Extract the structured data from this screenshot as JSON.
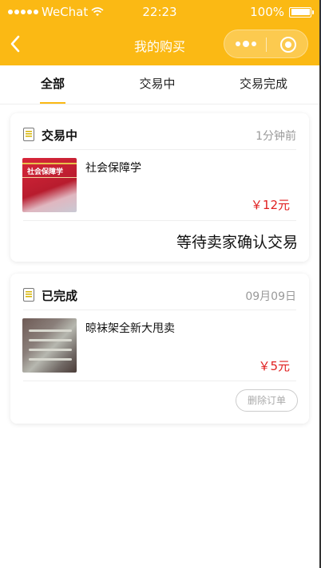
{
  "statusbar": {
    "carrier": "WeChat",
    "time": "22:23",
    "battery": "100%"
  },
  "navbar": {
    "title": "我的购买"
  },
  "tabs": [
    {
      "label": "全部",
      "active": true
    },
    {
      "label": "交易中",
      "active": false
    },
    {
      "label": "交易完成",
      "active": false
    }
  ],
  "orders": [
    {
      "status": "交易中",
      "time": "1分钟前",
      "item_name": "社会保障学",
      "thumb_text": "社会保障学",
      "price": "￥12元",
      "state_text": "等待卖家确认交易"
    },
    {
      "status": "已完成",
      "time": "09月09日",
      "item_name": "晾袜架全新大甩卖",
      "price": "￥5元",
      "action_label": "删除订单"
    }
  ],
  "colors": {
    "accent": "#fbb914",
    "price": "#e02020"
  }
}
